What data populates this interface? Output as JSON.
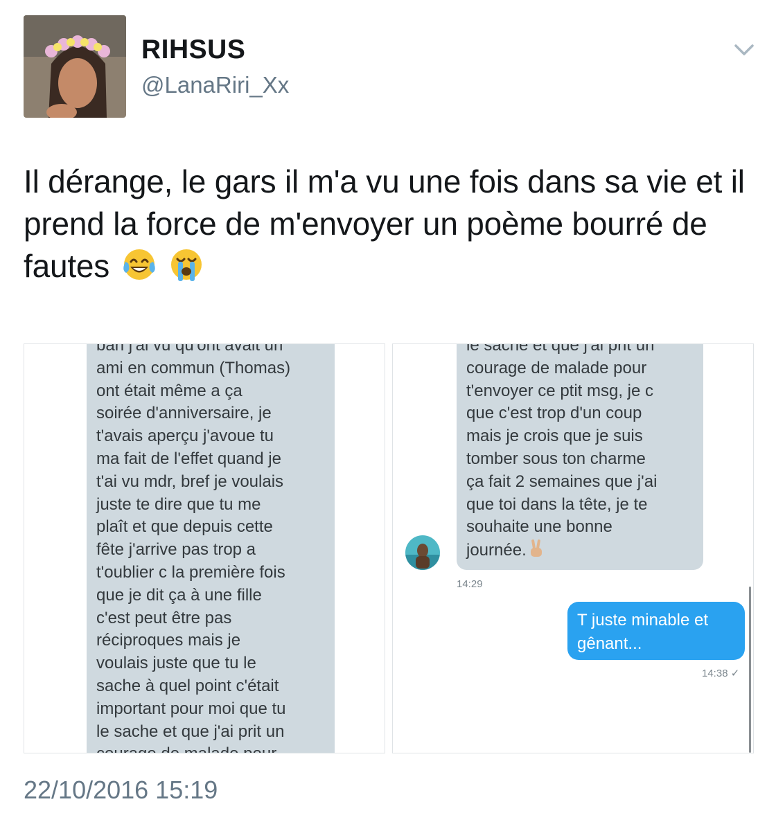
{
  "profile": {
    "display_name": "RIHSUS",
    "handle": "@LanaRiri_Xx"
  },
  "tweet": {
    "text": "Il dérange, le gars il m'a vu une fois dans sa vie et il prend la force de m'envoyer un poème bourré de fautes",
    "emojis": [
      "face-with-tears-of-joy",
      "loudly-crying-face"
    ],
    "timestamp": "22/10/2016 15:19"
  },
  "screenshot_left": {
    "message_lines": [
      "ban j'ai vu qu'ont avait un",
      "ami en commun (Thomas)",
      "ont était même a ça",
      "soirée d'anniversaire, je",
      "t'avais aperçu j'avoue tu",
      "ma fait de l'effet quand je",
      "t'ai vu mdr, bref je voulais",
      "juste te dire que tu me",
      "plaît et que depuis cette",
      "fête j'arrive pas trop a",
      "t'oublier c la première fois",
      "que je dit ça à une fille",
      "c'est peut être pas",
      "réciproques mais je",
      "voulais juste que tu le",
      "sache à quel point c'était",
      "important pour moi que tu",
      "le sache et que j'ai prit un",
      "courage de malade pour"
    ]
  },
  "screenshot_right": {
    "message_lines": [
      "le sache et que j'ai prit un",
      "courage de malade pour",
      "t'envoyer ce ptit msg, je c",
      "que c'est trop d'un coup",
      "mais je crois que je suis",
      "tomber sous ton charme",
      "ça fait 2 semaines que j'ai",
      "que toi dans la tête, je te",
      "souhaite une bonne",
      "journée."
    ],
    "received_time": "14:29",
    "reply_lines": [
      "T juste minable et",
      "gênant..."
    ],
    "reply_time": "14:38 ✓"
  },
  "colors": {
    "grey_bubble": "#cfd9df",
    "blue_bubble": "#2aa2f0",
    "secondary_text": "#657786"
  }
}
